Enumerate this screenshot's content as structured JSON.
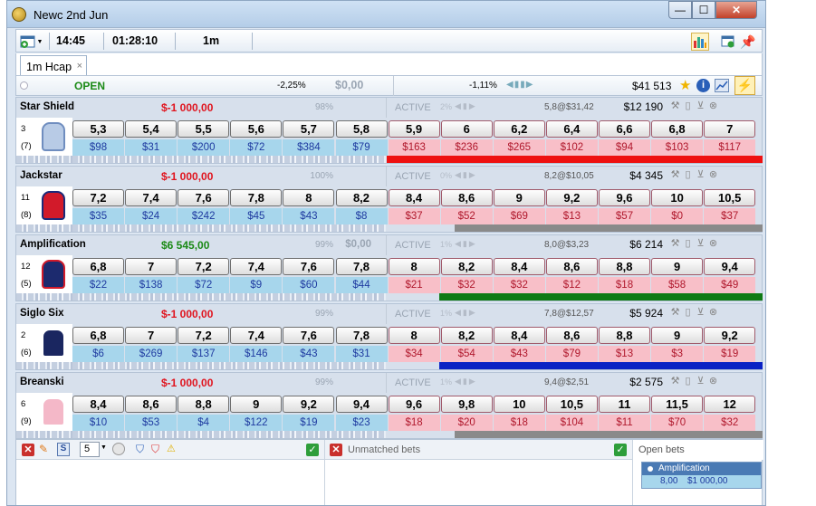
{
  "window": {
    "title": "Newc 2nd Jun",
    "controls": {
      "minimize": "—",
      "maximize": "☐",
      "close": "✕"
    }
  },
  "toolbar": {
    "time": "14:45",
    "countdown": "01:28:10",
    "distance": "1m"
  },
  "tabs": [
    {
      "label": "1m Hcap",
      "close": "×"
    }
  ],
  "summary": {
    "status": "OPEN",
    "back_overround": "-2,25%",
    "back_total": "$0,00",
    "lay_overround": "-1,11%",
    "matched": "$41 513"
  },
  "runners": [
    {
      "name": "Star Shield",
      "pl": "$-1 000,00",
      "pl_color": "#e0141e",
      "pct": "98%",
      "exposure": "",
      "status": "ACTIVE",
      "pct2": "2%",
      "last": "5,8@$31,42",
      "profit": "$12 190",
      "number": "3",
      "draw": "(7)",
      "back_prices": [
        "5,3",
        "5,4",
        "5,5",
        "5,6",
        "5,7",
        "5,8"
      ],
      "back_amounts": [
        "$98",
        "$31",
        "$200",
        "$72",
        "$384",
        "$79"
      ],
      "lay_prices": [
        "5,9",
        "6",
        "6,2",
        "6,4",
        "6,6",
        "6,8",
        "7"
      ],
      "lay_amounts": [
        "$163",
        "$236",
        "$265",
        "$102",
        "$94",
        "$103",
        "$117"
      ],
      "bar_color": "#ee1111",
      "bar_start": 0.0,
      "silks": {
        "body": "#b8cbe6",
        "accent": "#6f8dbf"
      }
    },
    {
      "name": "Jackstar",
      "pl": "$-1 000,00",
      "pl_color": "#e0141e",
      "pct": "100%",
      "exposure": "",
      "status": "ACTIVE",
      "pct2": "0%",
      "last": "8,2@$10,05",
      "profit": "$4 345",
      "number": "11",
      "draw": "(8)",
      "back_prices": [
        "7,2",
        "7,4",
        "7,6",
        "7,8",
        "8",
        "8,2"
      ],
      "back_amounts": [
        "$35",
        "$24",
        "$242",
        "$45",
        "$43",
        "$8"
      ],
      "lay_prices": [
        "8,4",
        "8,6",
        "9",
        "9,2",
        "9,6",
        "10",
        "10,5"
      ],
      "lay_amounts": [
        "$37",
        "$52",
        "$69",
        "$13",
        "$57",
        "$0",
        "$37"
      ],
      "bar_color": "#8a8a8a",
      "bar_start": 0.18,
      "silks": {
        "body": "#d21a2a",
        "accent": "#1a2a7a"
      }
    },
    {
      "name": "Amplification",
      "pl": "$6 545,00",
      "pl_color": "#1b8a16",
      "pct": "99%",
      "exposure": "$0,00",
      "status": "ACTIVE",
      "pct2": "1%",
      "last": "8,0@$3,23",
      "profit": "$6 214",
      "number": "12",
      "draw": "(5)",
      "back_prices": [
        "6,8",
        "7",
        "7,2",
        "7,4",
        "7,6",
        "7,8"
      ],
      "back_amounts": [
        "$22",
        "$138",
        "$72",
        "$9",
        "$60",
        "$44"
      ],
      "lay_prices": [
        "8",
        "8,2",
        "8,4",
        "8,6",
        "8,8",
        "9",
        "9,4"
      ],
      "lay_amounts": [
        "$21",
        "$32",
        "$32",
        "$12",
        "$18",
        "$58",
        "$49"
      ],
      "bar_color": "#0f7a14",
      "bar_start": 0.14,
      "silks": {
        "body": "#1c2a6e",
        "accent": "#d21a2a"
      }
    },
    {
      "name": "Siglo Six",
      "pl": "$-1 000,00",
      "pl_color": "#e0141e",
      "pct": "99%",
      "exposure": "",
      "status": "ACTIVE",
      "pct2": "1%",
      "last": "7,8@$12,57",
      "profit": "$5 924",
      "number": "2",
      "draw": "(6)",
      "back_prices": [
        "6,8",
        "7",
        "7,2",
        "7,4",
        "7,6",
        "7,8"
      ],
      "back_amounts": [
        "$6",
        "$269",
        "$137",
        "$146",
        "$43",
        "$31"
      ],
      "lay_prices": [
        "8",
        "8,2",
        "8,4",
        "8,6",
        "8,8",
        "9",
        "9,2"
      ],
      "lay_amounts": [
        "$34",
        "$54",
        "$43",
        "$79",
        "$13",
        "$3",
        "$19"
      ],
      "bar_color": "#0a22c4",
      "bar_start": 0.14,
      "silks": {
        "body": "#1a2660",
        "accent": "#ffffff"
      }
    },
    {
      "name": "Breanski",
      "pl": "$-1 000,00",
      "pl_color": "#e0141e",
      "pct": "99%",
      "exposure": "",
      "status": "ACTIVE",
      "pct2": "1%",
      "last": "9,4@$2,51",
      "profit": "$2 575",
      "number": "6",
      "draw": "(9)",
      "back_prices": [
        "8,4",
        "8,6",
        "8,8",
        "9",
        "9,2",
        "9,4"
      ],
      "back_amounts": [
        "$10",
        "$53",
        "$4",
        "$122",
        "$19",
        "$23"
      ],
      "lay_prices": [
        "9,6",
        "9,8",
        "10",
        "10,5",
        "11",
        "11,5",
        "12"
      ],
      "lay_amounts": [
        "$18",
        "$20",
        "$18",
        "$104",
        "$11",
        "$70",
        "$32"
      ],
      "bar_color": "#8a8a8a",
      "bar_start": 0.18,
      "silks": {
        "body": "#f4b8c8",
        "accent": "#ffffff"
      }
    }
  ],
  "bottom": {
    "stake_value": "5",
    "s_label": "S",
    "unmatched_title": "Unmatched bets",
    "open_bets_title": "Open bets",
    "open_bet": {
      "name": "Amplification",
      "price": "8,00",
      "stake": "$1 000,00"
    }
  }
}
